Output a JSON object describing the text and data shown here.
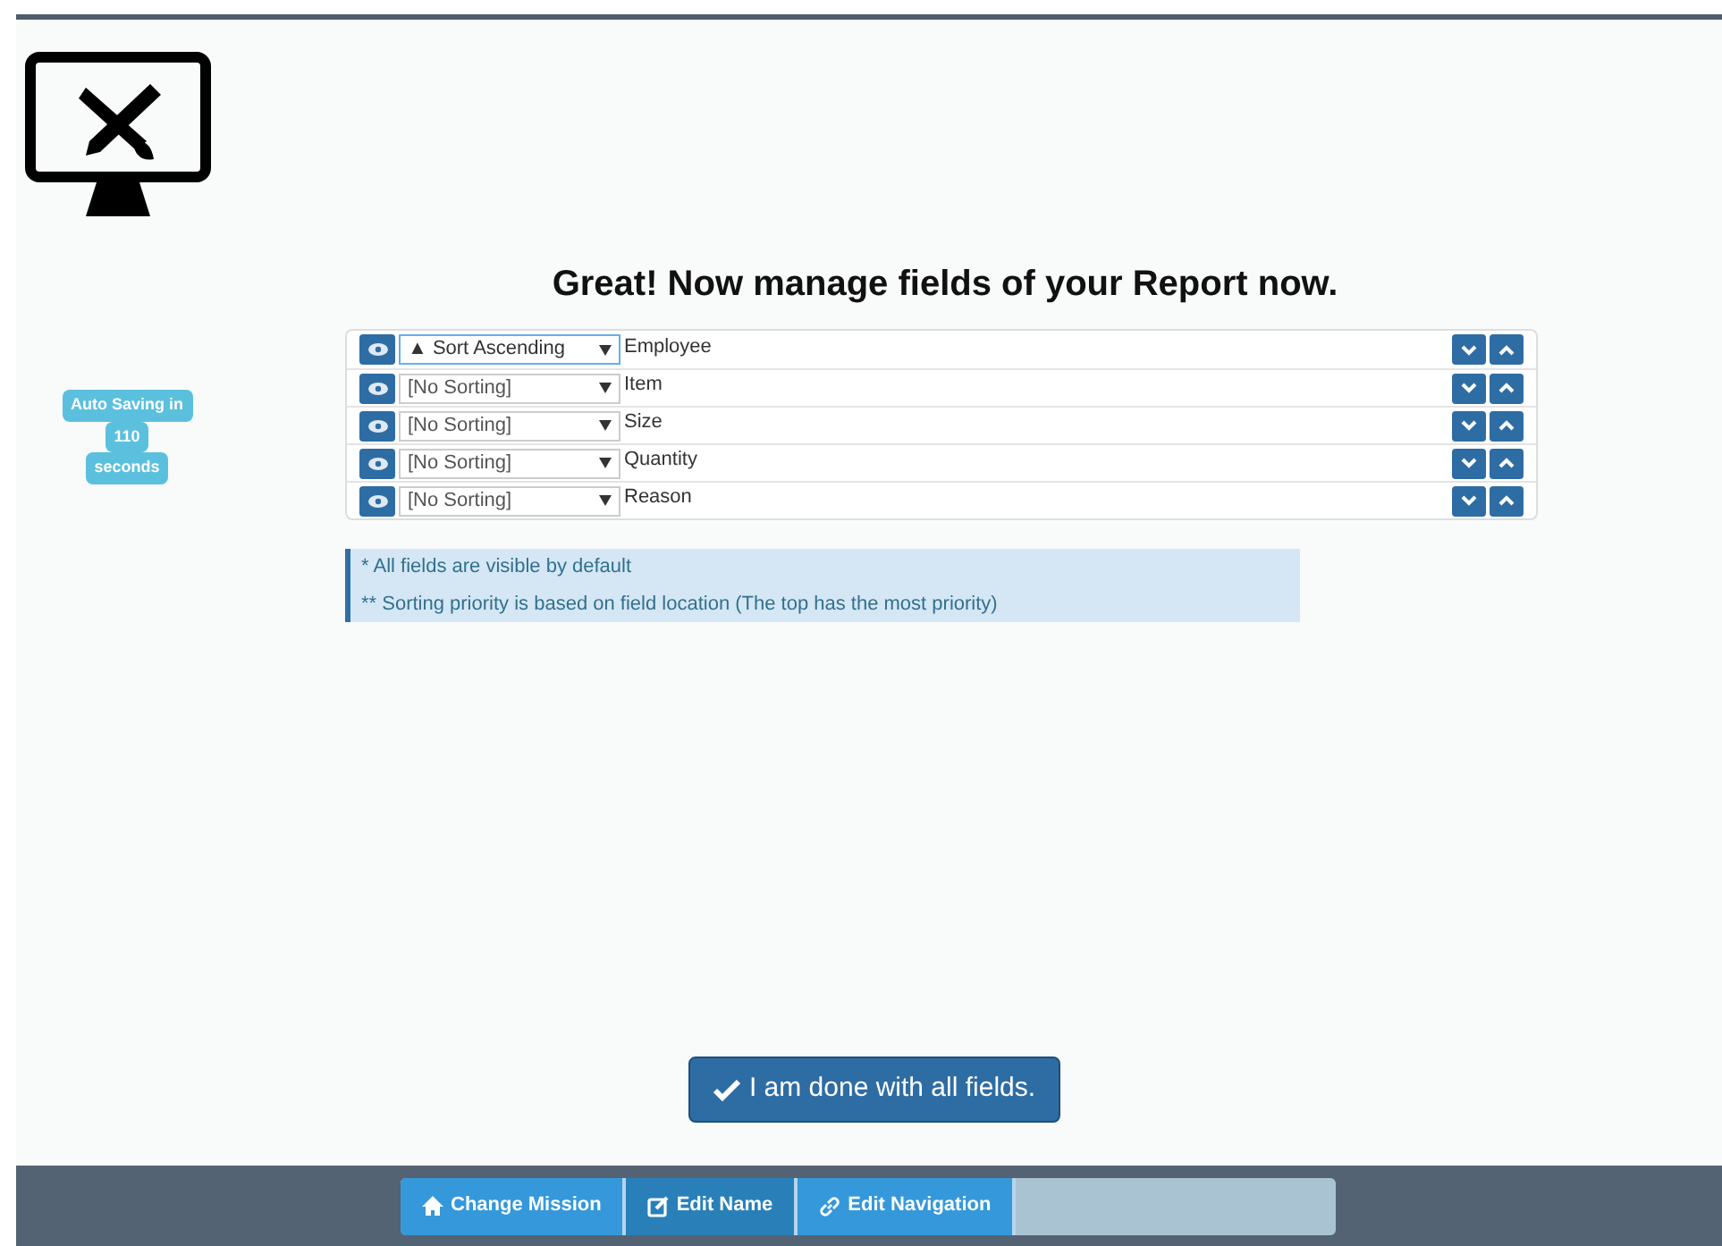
{
  "title": "Great! Now manage fields of your Report now.",
  "autosave": {
    "lines": [
      "Auto Saving in",
      "110",
      "seconds"
    ]
  },
  "fields": [
    {
      "sorting": "▲ Sort Ascending",
      "name": "Employee",
      "focused": true
    },
    {
      "sorting": "[No Sorting]",
      "name": "Item",
      "focused": false
    },
    {
      "sorting": "[No Sorting]",
      "name": "Size",
      "focused": false
    },
    {
      "sorting": "[No Sorting]",
      "name": "Quantity",
      "focused": false
    },
    {
      "sorting": "[No Sorting]",
      "name": "Reason",
      "focused": false
    }
  ],
  "notes": [
    "* All fields are visible by default",
    "** Sorting priority is based on field location (The top has the most priority)"
  ],
  "done_button": "I am done with all fields.",
  "breadcrumbs": [
    {
      "label": "Change Mission",
      "selected": false
    },
    {
      "label": "Edit Name",
      "selected": true
    },
    {
      "label": "Edit Navigation",
      "selected": false
    }
  ]
}
